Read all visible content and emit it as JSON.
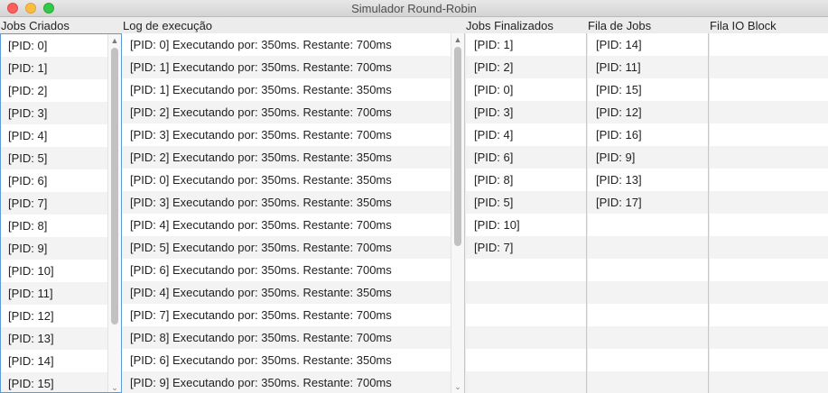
{
  "window": {
    "title": "Simulador Round-Robin"
  },
  "headers": {
    "created": "Jobs Criados",
    "log": "Log de execução",
    "finished": "Jobs Finalizados",
    "queue": "Fila de Jobs",
    "io": "Fila IO Block"
  },
  "created": [
    "[PID: 0]",
    "[PID: 1]",
    "[PID: 2]",
    "[PID: 3]",
    "[PID: 4]",
    "[PID: 5]",
    "[PID: 6]",
    "[PID: 7]",
    "[PID: 8]",
    "[PID: 9]",
    "[PID: 10]",
    "[PID: 11]",
    "[PID: 12]",
    "[PID: 13]",
    "[PID: 14]",
    "[PID: 15]"
  ],
  "log": [
    "[PID: 0] Executando por: 350ms. Restante: 700ms",
    "[PID: 1] Executando por: 350ms. Restante: 700ms",
    "[PID: 1] Executando por: 350ms. Restante: 350ms",
    "[PID: 2] Executando por: 350ms. Restante: 700ms",
    "[PID: 3] Executando por: 350ms. Restante: 700ms",
    "[PID: 2] Executando por: 350ms. Restante: 350ms",
    "[PID: 0] Executando por: 350ms. Restante: 350ms",
    "[PID: 3] Executando por: 350ms. Restante: 350ms",
    "[PID: 4] Executando por: 350ms. Restante: 700ms",
    "[PID: 5] Executando por: 350ms. Restante: 700ms",
    "[PID: 6] Executando por: 350ms. Restante: 700ms",
    "[PID: 4] Executando por: 350ms. Restante: 350ms",
    "[PID: 7] Executando por: 350ms. Restante: 700ms",
    "[PID: 8] Executando por: 350ms. Restante: 700ms",
    "[PID: 6] Executando por: 350ms. Restante: 350ms",
    "[PID: 9] Executando por: 350ms. Restante: 700ms"
  ],
  "finished": [
    "[PID: 1]",
    "[PID: 2]",
    "[PID: 0]",
    "[PID: 3]",
    "[PID: 4]",
    "[PID: 6]",
    "[PID: 8]",
    "[PID: 5]",
    "[PID: 10]",
    "[PID: 7]"
  ],
  "queue": [
    "[PID: 14]",
    "[PID: 11]",
    "[PID: 15]",
    "[PID: 12]",
    "[PID: 16]",
    "[PID: 9]",
    "[PID: 13]",
    "[PID: 17]"
  ],
  "io": [],
  "colors": {
    "close": "#fc605c",
    "minimize": "#fdbc40",
    "zoom": "#34c84a",
    "focus_border": "#5b9ad8",
    "stripe": "#f3f3f3"
  }
}
